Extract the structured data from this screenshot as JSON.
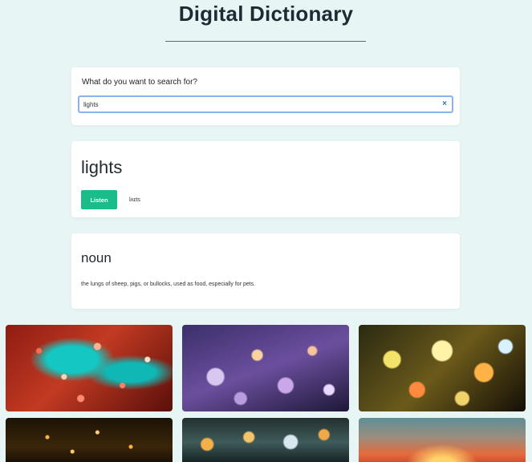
{
  "header": {
    "title": "Digital Dictionary"
  },
  "search": {
    "label": "What do you want to search for?",
    "value": "lights",
    "clear_icon": "close-icon",
    "clear_glyph": "×"
  },
  "entry": {
    "word": "lights",
    "listen_label": "Listen",
    "phonetic": "lʌɪts"
  },
  "meaning": {
    "part_of_speech": "noun",
    "definition": "the lungs of sheep, pigs, or bullocks, used as food, especially for pets."
  },
  "colors": {
    "background": "#e8f5f5",
    "accent": "#1abc8a",
    "focus": "#87b3ef"
  }
}
